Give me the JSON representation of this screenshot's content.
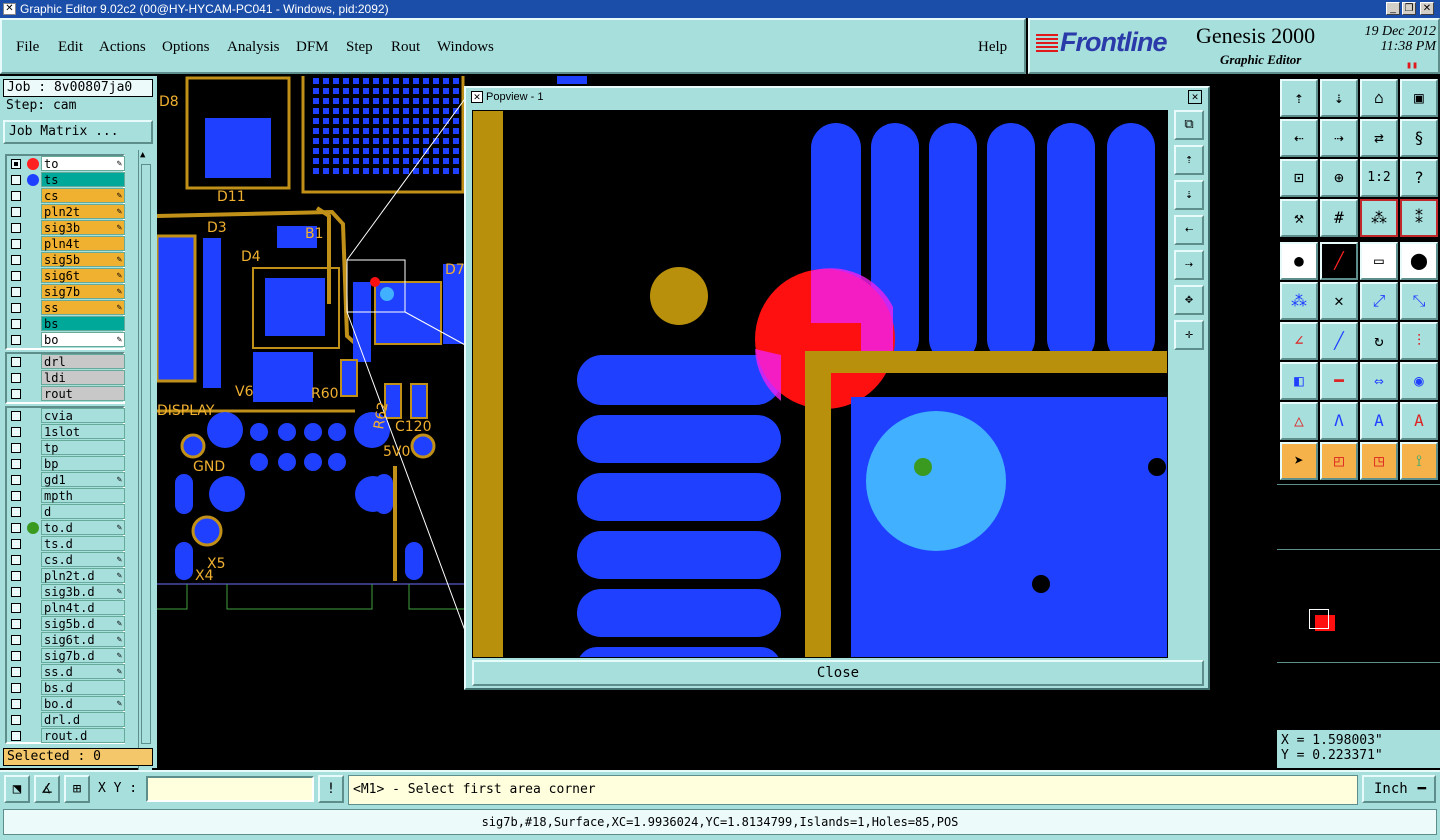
{
  "window": {
    "title": "Graphic Editor 9.02c2 (00@HY-HYCAM-PC041 - Windows, pid:2092)",
    "minimize": "_",
    "restore": "❐",
    "close": "✕"
  },
  "menu": [
    "File",
    "Edit",
    "Actions",
    "Options",
    "Analysis",
    "DFM",
    "Step",
    "Rout",
    "Windows"
  ],
  "help": "Help",
  "brand": {
    "logo": "Frontline",
    "product": "Genesis 2000",
    "subtitle": "Graphic Editor",
    "date": "19 Dec 2012",
    "time": "11:38 PM"
  },
  "job": {
    "job_label": "Job : 8v00807ja0",
    "step_label": "Step: cam",
    "matrix_button": "Job Matrix ...",
    "selected": "Selected : 0"
  },
  "layers_board": [
    {
      "name": "to",
      "color": "#ffffff",
      "dot": "#ff2020",
      "edit": true,
      "active": true
    },
    {
      "name": "ts",
      "color": "#00a89a",
      "dot": "#2040ff",
      "edit": false
    },
    {
      "name": "cs",
      "color": "#f0b030",
      "dot": "",
      "edit": true
    },
    {
      "name": "pln2t",
      "color": "#f0b030",
      "dot": "",
      "edit": true
    },
    {
      "name": "sig3b",
      "color": "#f0b030",
      "dot": "",
      "edit": true
    },
    {
      "name": "pln4t",
      "color": "#f0b030",
      "dot": "",
      "edit": false
    },
    {
      "name": "sig5b",
      "color": "#f0b030",
      "dot": "",
      "edit": true
    },
    {
      "name": "sig6t",
      "color": "#f0b030",
      "dot": "",
      "edit": true
    },
    {
      "name": "sig7b",
      "color": "#f0b030",
      "dot": "",
      "edit": true
    },
    {
      "name": "ss",
      "color": "#f0b030",
      "dot": "",
      "edit": true
    },
    {
      "name": "bs",
      "color": "#00a89a",
      "dot": "",
      "edit": false
    },
    {
      "name": "bo",
      "color": "#ffffff",
      "dot": "",
      "edit": true
    }
  ],
  "layers_drill": [
    {
      "name": "drl",
      "color": "#c8c8c8"
    },
    {
      "name": "ldi",
      "color": "#c8c8c8"
    },
    {
      "name": "rout",
      "color": "#c8c8c8"
    }
  ],
  "layers_misc": [
    {
      "name": "cvia",
      "dot": "",
      "edit": false
    },
    {
      "name": "1slot",
      "dot": "",
      "edit": false
    },
    {
      "name": "tp",
      "dot": "",
      "edit": false
    },
    {
      "name": "bp",
      "dot": "",
      "edit": false
    },
    {
      "name": "gd1",
      "dot": "",
      "edit": true
    },
    {
      "name": "mpth",
      "dot": "",
      "edit": false
    },
    {
      "name": "d",
      "dot": "",
      "edit": false
    },
    {
      "name": "to.d",
      "dot": "#3a9a20",
      "edit": true
    },
    {
      "name": "ts.d",
      "dot": "",
      "edit": false
    },
    {
      "name": "cs.d",
      "dot": "",
      "edit": true
    },
    {
      "name": "pln2t.d",
      "dot": "",
      "edit": true
    },
    {
      "name": "sig3b.d",
      "dot": "",
      "edit": true
    },
    {
      "name": "pln4t.d",
      "dot": "",
      "edit": false
    },
    {
      "name": "sig5b.d",
      "dot": "",
      "edit": true
    },
    {
      "name": "sig6t.d",
      "dot": "",
      "edit": true
    },
    {
      "name": "sig7b.d",
      "dot": "",
      "edit": true
    },
    {
      "name": "ss.d",
      "dot": "",
      "edit": true
    },
    {
      "name": "bs.d",
      "dot": "",
      "edit": false
    },
    {
      "name": "bo.d",
      "dot": "",
      "edit": true
    },
    {
      "name": "drl.d",
      "dot": "",
      "edit": false
    },
    {
      "name": "rout.d",
      "dot": "",
      "edit": false
    }
  ],
  "board_labels": {
    "d8": "D8",
    "d11": "D11",
    "d3": "D3",
    "b1": "B1",
    "d4": "D4",
    "d7": "D7",
    "v6": "V6",
    "r60": "R60",
    "r62": "R62",
    "c120": "C120",
    "display": "DISPLAY",
    "gnd": "GND",
    "5v0": "5V0",
    "x5": "X5",
    "x4": "X4"
  },
  "popview": {
    "title": "Popview - 1",
    "close_label": "Close"
  },
  "coords": {
    "x": "X = 1.598003\"",
    "y": "Y = 0.223371\""
  },
  "xy_label": "X Y :",
  "message": "<M1> - Select first area corner",
  "units": "Inch",
  "status": "sig7b,#18,Surface,XC=1.9936024,YC=1.8134799,Islands=1,Holes=85,POS"
}
